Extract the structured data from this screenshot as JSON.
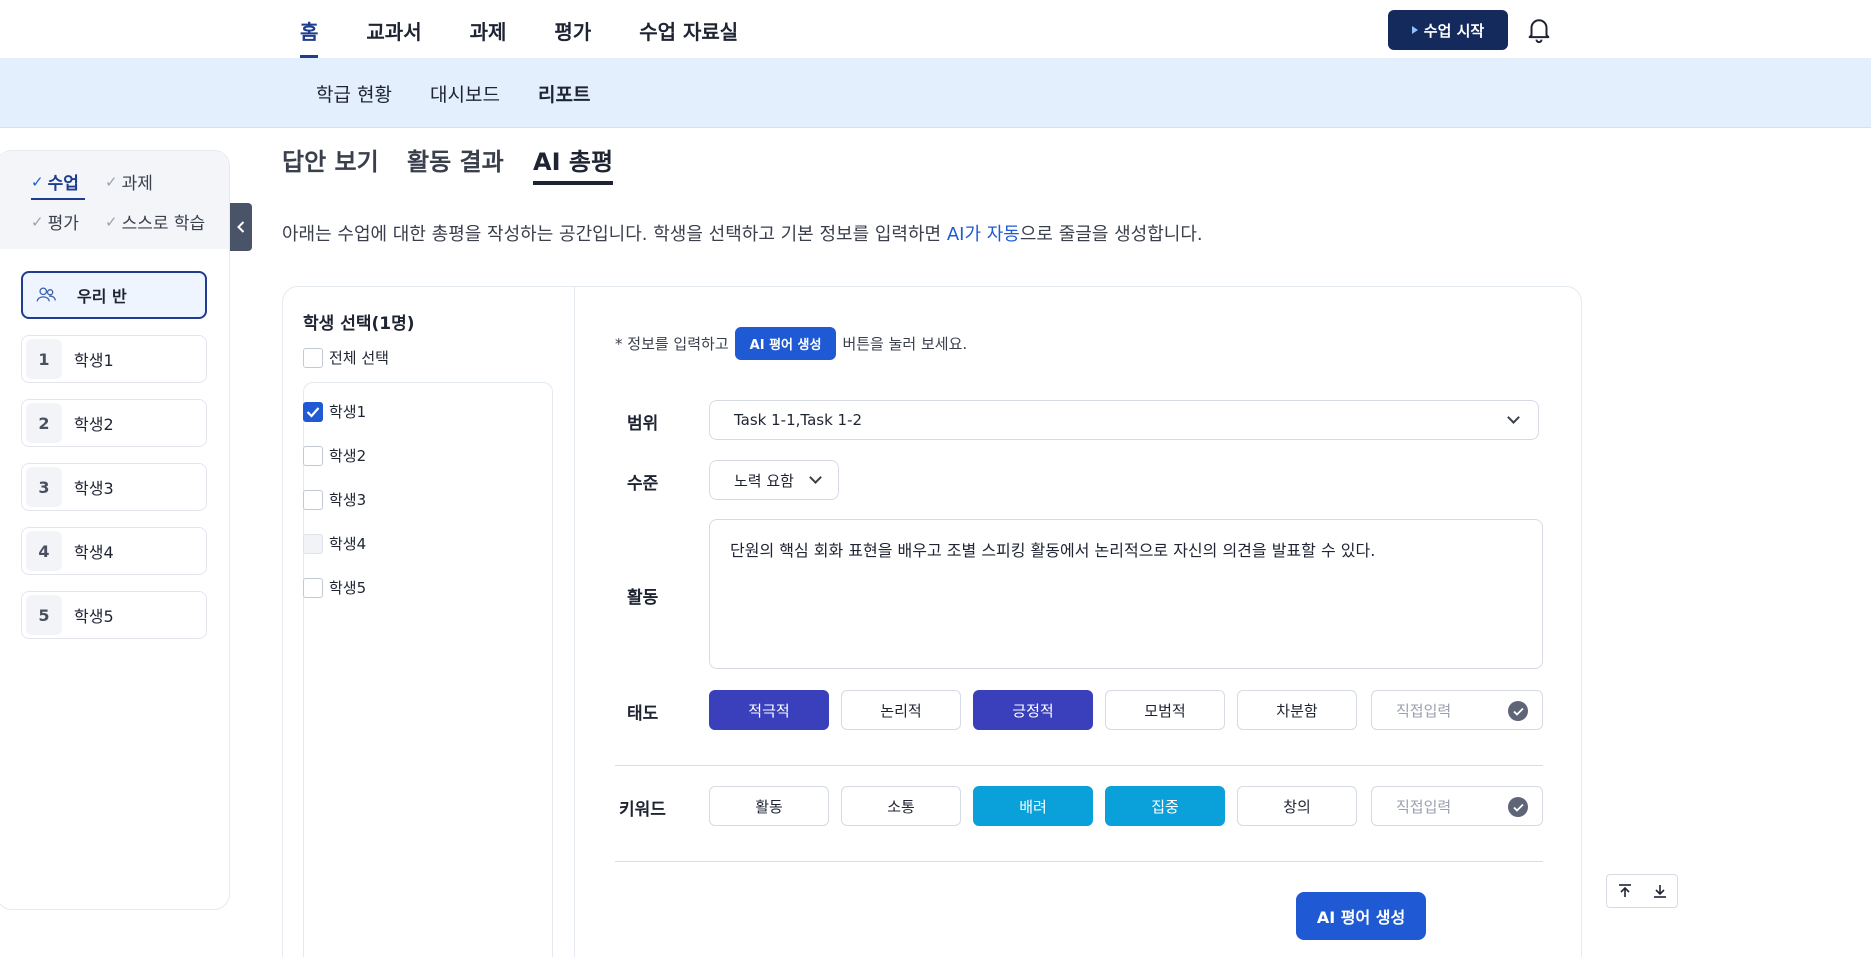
{
  "topnav": {
    "items": [
      "홈",
      "교과서",
      "과제",
      "평가",
      "수업 자료실"
    ],
    "active_index": 0,
    "start_button": "수업 시작"
  },
  "subnav": {
    "items": [
      "학급 현황",
      "대시보드",
      "리포트"
    ],
    "active_index": 2
  },
  "sidebar": {
    "filters": [
      "수업",
      "과제",
      "평가",
      "스스로 학습"
    ],
    "active_filter": "수업",
    "class_label": "우리 반",
    "students": [
      {
        "num": "1",
        "name": "학생1"
      },
      {
        "num": "2",
        "name": "학생2"
      },
      {
        "num": "3",
        "name": "학생3"
      },
      {
        "num": "4",
        "name": "학생4"
      },
      {
        "num": "5",
        "name": "학생5"
      }
    ]
  },
  "tabs": [
    "답안 보기",
    "활동 결과",
    "AI 총평"
  ],
  "active_tab": "AI 총평",
  "description": {
    "before": "아래는 수업에 대한 총평을 작성하는 공간입니다. 학생을 선택하고 기본 정보를 입력하면 ",
    "highlight": "AI가 자동",
    "after": "으로 줄글을 생성합니다."
  },
  "student_select": {
    "title": "학생 선택(1명)",
    "select_all": "전체 선택",
    "students": [
      {
        "name": "학생1",
        "state": "checked"
      },
      {
        "name": "학생2",
        "state": "unchecked"
      },
      {
        "name": "학생3",
        "state": "unchecked"
      },
      {
        "name": "학생4",
        "state": "disabled"
      },
      {
        "name": "학생5",
        "state": "unchecked"
      }
    ]
  },
  "form": {
    "hint_before": "* 정보를 입력하고",
    "hint_pill": "AI 평어 생성",
    "hint_after": "버튼을 눌러 보세요.",
    "range_label": "범위",
    "range_value": "Task 1-1,Task 1-2",
    "level_label": "수준",
    "level_value": "노력 요함",
    "activity_label": "활동",
    "activity_text": "단원의 핵심 회화 표현을 배우고 조별 스피킹 활동에서 논리적으로 자신의 의견을 발표할 수 있다.",
    "attitude_label": "태도",
    "attitude_chips": [
      {
        "label": "적극적",
        "selected": true
      },
      {
        "label": "논리적",
        "selected": false
      },
      {
        "label": "긍정적",
        "selected": true
      },
      {
        "label": "모범적",
        "selected": false
      },
      {
        "label": "차분함",
        "selected": false
      }
    ],
    "direct_input_placeholder": "직접입력",
    "keyword_label": "키워드",
    "keyword_chips": [
      {
        "label": "활동",
        "selected": false
      },
      {
        "label": "소통",
        "selected": false
      },
      {
        "label": "배려",
        "selected": true
      },
      {
        "label": "집중",
        "selected": true
      },
      {
        "label": "창의",
        "selected": false
      }
    ],
    "generate_button": "AI 평어 생성"
  },
  "colors": {
    "primary": "#1f5ad4",
    "navy": "#152a5c",
    "attitude_selected": "#3a3fbb",
    "keyword_selected": "#0aa0d9",
    "subnav_bg": "#e3effc"
  }
}
